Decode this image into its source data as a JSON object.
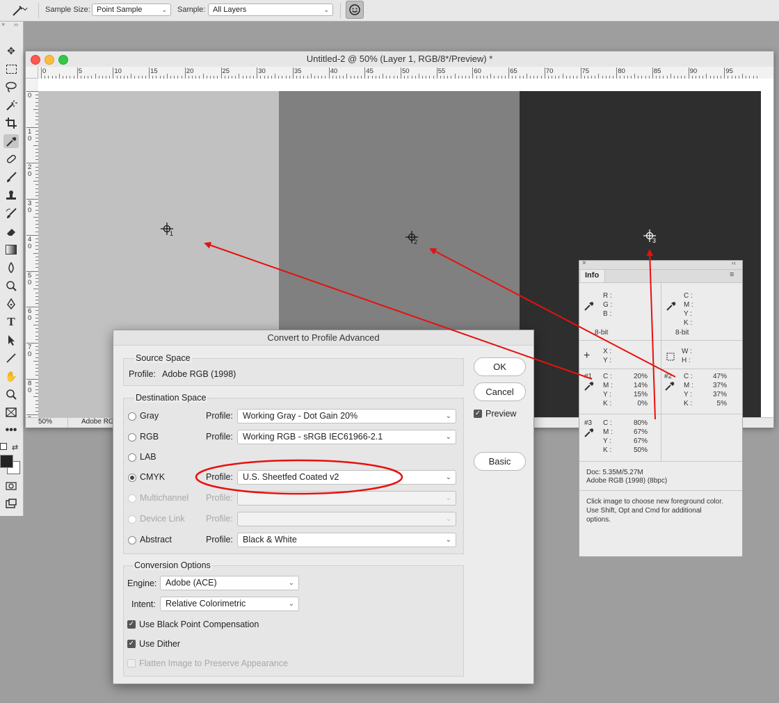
{
  "options_bar": {
    "sample_size_label": "Sample Size:",
    "sample_size_value": "Point Sample",
    "sample_label": "Sample:",
    "sample_value": "All Layers",
    "tool_icon": "eyedropper-icon",
    "sample_ring_icon": "smiley-icon"
  },
  "toolbox": {
    "tools": [
      "move-icon",
      "marquee-icon",
      "lasso-icon",
      "magic-wand-icon",
      "crop-icon",
      "eyedropper-icon",
      "healing-brush-icon",
      "brush-icon",
      "stamp-icon",
      "history-brush-icon",
      "eraser-icon",
      "gradient-icon",
      "blur-icon",
      "dodge-icon",
      "pen-icon",
      "type-icon",
      "path-selection-icon",
      "line-icon",
      "hand-icon",
      "zoom-icon",
      "frame-icon",
      "more-icon"
    ],
    "foreground_color": "#222222",
    "background_color": "#ffffff"
  },
  "document": {
    "title": "Untitled-2 @ 50% (Layer 1, RGB/8*/Preview) *",
    "zoom": "50%",
    "status": "Adobe RG",
    "h_ruler": [
      "0",
      "5",
      "10",
      "15",
      "20",
      "25",
      "30",
      "35",
      "40",
      "45",
      "50",
      "55",
      "60",
      "65",
      "70",
      "75",
      "80",
      "85",
      "90",
      "95"
    ],
    "v_ruler": [
      "0",
      "1 0",
      "2 0",
      "3 0",
      "4 0",
      "5 0",
      "6 0",
      "7 0",
      "8 0",
      "9 0"
    ],
    "swatches": [
      "#c1c1c1",
      "#808080",
      "#2e2e2e"
    ],
    "samplers": [
      "1",
      "2",
      "3"
    ]
  },
  "info_panel": {
    "tab": "Info",
    "rgb_labels": [
      "R :",
      "G :",
      "B :"
    ],
    "cmyk_labels": [
      "C :",
      "M :",
      "Y :",
      "K :"
    ],
    "bit_left": "8-bit",
    "bit_right": "8-bit",
    "xy_labels": [
      "X :",
      "Y :"
    ],
    "wh_labels": [
      "W :",
      "H :"
    ],
    "s1": {
      "id": "#1",
      "vals": [
        "20%",
        "14%",
        "15%",
        "0%"
      ]
    },
    "s2": {
      "id": "#2",
      "vals": [
        "47%",
        "37%",
        "37%",
        "5%"
      ]
    },
    "s3": {
      "id": "#3",
      "vals": [
        "80%",
        "67%",
        "67%",
        "50%"
      ]
    },
    "doc_line": "Doc: 5.35M/5.27M",
    "profile_line": "Adobe RGB (1998) (8bpc)",
    "help_text": "Click image to choose new foreground color.  Use Shift, Opt and Cmd for additional options."
  },
  "dialog": {
    "title": "Convert to Profile Advanced",
    "source_space_label": "Source Space",
    "source_profile_label": "Profile:",
    "source_profile_value": "Adobe RGB (1998)",
    "destination_label": "Destination Space",
    "profile_label": "Profile:",
    "rows": [
      {
        "label": "Gray",
        "profile": "Working Gray - Dot Gain 20%"
      },
      {
        "label": "RGB",
        "profile": "Working RGB - sRGB IEC61966-2.1"
      },
      {
        "label": "LAB",
        "profile": ""
      },
      {
        "label": "CMYK",
        "profile": "U.S. Sheetfed Coated v2"
      },
      {
        "label": "Multichannel",
        "profile": ""
      },
      {
        "label": "Device Link",
        "profile": ""
      },
      {
        "label": "Abstract",
        "profile": "Black & White"
      }
    ],
    "conversion_label": "Conversion Options",
    "engine_label": "Engine:",
    "engine_value": "Adobe (ACE)",
    "intent_label": "Intent:",
    "intent_value": "Relative Colorimetric",
    "black_point": "Use Black Point Compensation",
    "dither": "Use Dither",
    "flatten": "Flatten Image to Preserve Appearance",
    "ok": "OK",
    "cancel": "Cancel",
    "preview": "Preview",
    "basic": "Basic"
  },
  "annotation_color": "#e8100e"
}
